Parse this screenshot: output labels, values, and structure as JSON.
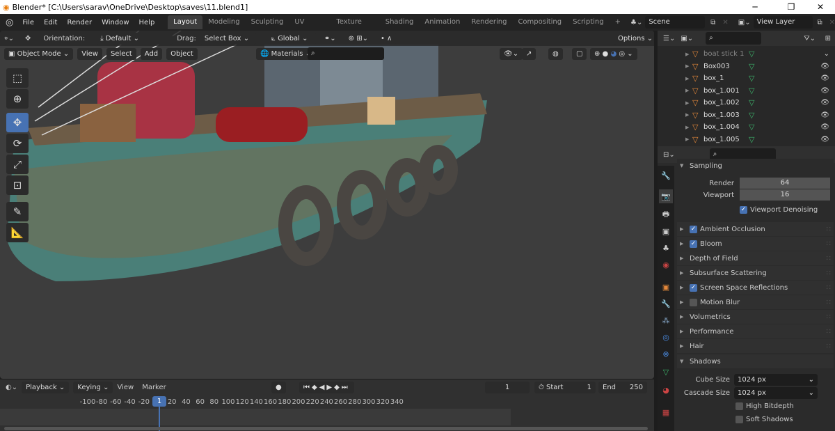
{
  "window": {
    "title": "Blender* [C:\\Users\\sarav\\OneDrive\\Desktop\\saves\\11.blend1]",
    "minimize": "─",
    "maximize": "❐",
    "close": "✕"
  },
  "menu": [
    "File",
    "Edit",
    "Render",
    "Window",
    "Help"
  ],
  "workspaces": [
    "Layout",
    "Modeling",
    "Sculpting",
    "UV Editing",
    "Texture Paint",
    "Shading",
    "Animation",
    "Rendering",
    "Compositing",
    "Scripting"
  ],
  "active_workspace": "Layout",
  "add_workspace": "+",
  "scene": "Scene",
  "view_layer": "View Layer",
  "tool_settings": {
    "orientation_label": "Orientation:",
    "orientation": "Default",
    "drag_label": "Drag:",
    "drag": "Select Box",
    "transform": "Global",
    "options": "Options"
  },
  "viewport_header": {
    "mode": "Object Mode",
    "view": "View",
    "select": "Select",
    "add": "Add",
    "object": "Object",
    "material": "Materials"
  },
  "outliner": {
    "items": [
      {
        "name": "boat stick 1",
        "dim": true
      },
      {
        "name": "Box003"
      },
      {
        "name": "box_1"
      },
      {
        "name": "box_1.001"
      },
      {
        "name": "box_1.002"
      },
      {
        "name": "box_1.003"
      },
      {
        "name": "box_1.004"
      },
      {
        "name": "box_1.005"
      }
    ]
  },
  "properties": {
    "sampling": {
      "title": "Sampling",
      "render_label": "Render",
      "render": "64",
      "viewport_label": "Viewport",
      "viewport": "16",
      "denoise": "Viewport Denoising",
      "denoise_checked": true
    },
    "panels": [
      {
        "label": "Ambient Occlusion",
        "checkbox": true,
        "checked": true
      },
      {
        "label": "Bloom",
        "checkbox": true,
        "checked": true
      },
      {
        "label": "Depth of Field",
        "checkbox": false
      },
      {
        "label": "Subsurface Scattering",
        "checkbox": false
      },
      {
        "label": "Screen Space Reflections",
        "checkbox": true,
        "checked": true
      },
      {
        "label": "Motion Blur",
        "checkbox": true,
        "checked": false
      },
      {
        "label": "Volumetrics",
        "checkbox": false
      },
      {
        "label": "Performance",
        "checkbox": false
      },
      {
        "label": "Hair",
        "checkbox": false
      }
    ],
    "shadows": {
      "title": "Shadows",
      "cube_label": "Cube Size",
      "cube": "1024 px",
      "cascade_label": "Cascade Size",
      "cascade": "1024 px",
      "high_bitdepth": "High Bitdepth",
      "soft_shadows": "Soft Shadows"
    }
  },
  "timeline": {
    "playback": "Playback",
    "keying": "Keying",
    "view": "View",
    "marker": "Marker",
    "current_frame": "1",
    "start_label": "Start",
    "start": "1",
    "end_label": "End",
    "end": "250",
    "ticks": [
      "-100",
      "-80",
      "-60",
      "-40",
      "-20",
      "1",
      "20",
      "40",
      "60",
      "80",
      "100",
      "120",
      "140",
      "160",
      "180",
      "200",
      "220",
      "240",
      "260",
      "280",
      "300",
      "320",
      "340"
    ]
  },
  "colors": {
    "accent": "#4772b3",
    "mesh": "#e5883a",
    "data": "#3db56b"
  }
}
